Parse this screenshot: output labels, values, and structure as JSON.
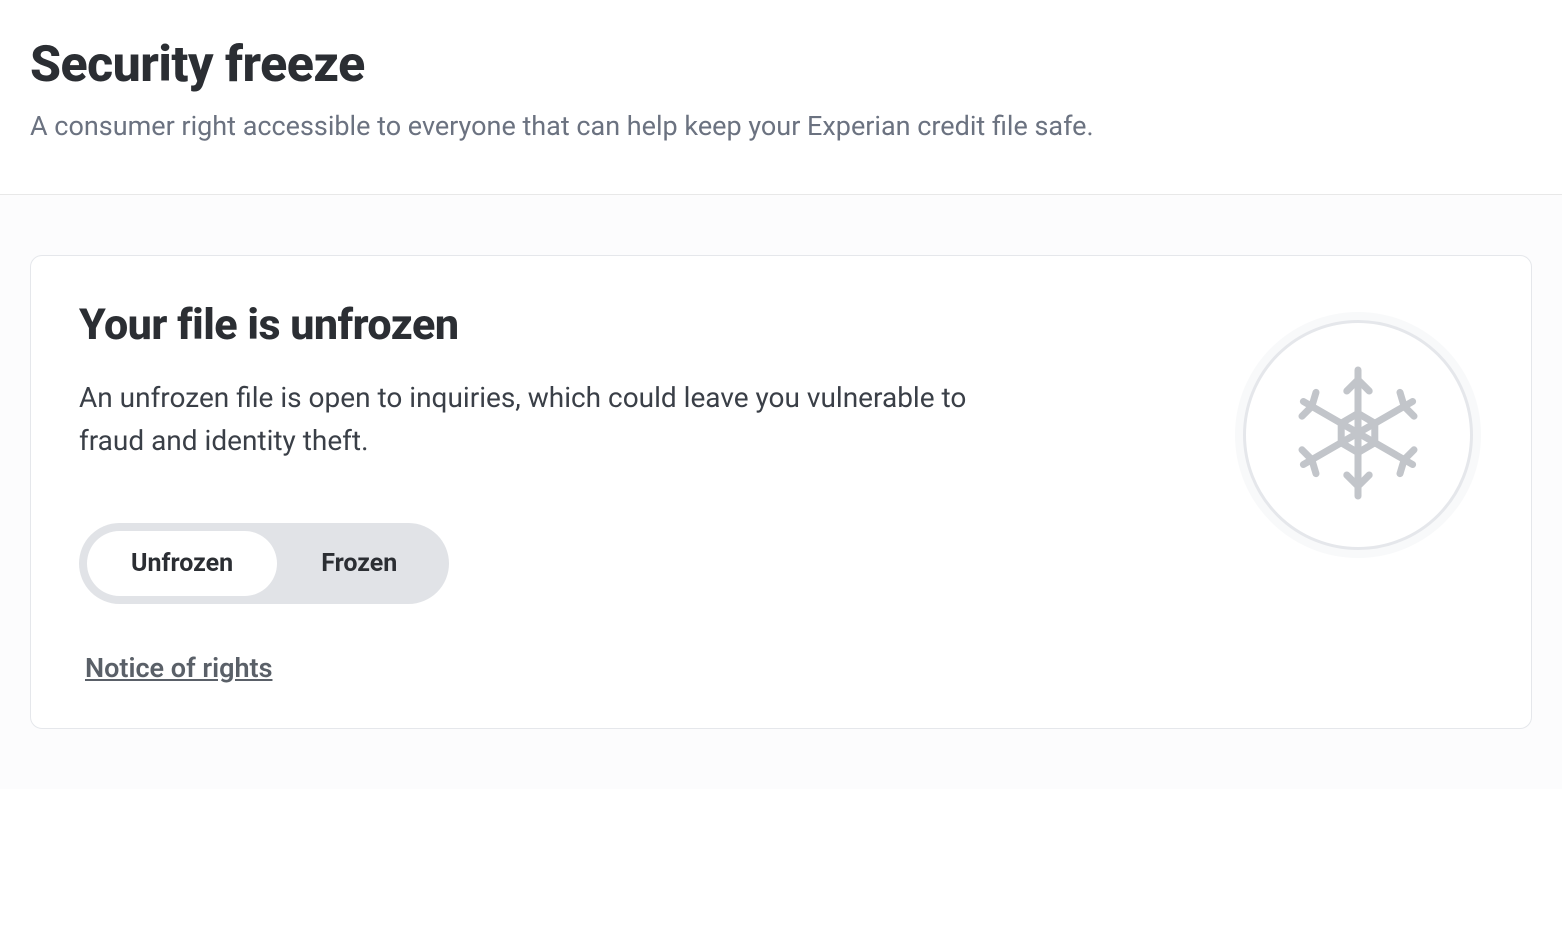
{
  "header": {
    "title": "Security freeze",
    "subtitle": "A consumer right accessible to everyone that can help keep your Experian credit file safe."
  },
  "card": {
    "title": "Your file is unfrozen",
    "description": "An unfrozen file is open to inquiries, which could leave you vulnerable to fraud and identity theft.",
    "toggle": {
      "unfrozen_label": "Unfrozen",
      "frozen_label": "Frozen",
      "active": "unfrozen"
    },
    "notice_link": "Notice of rights"
  }
}
